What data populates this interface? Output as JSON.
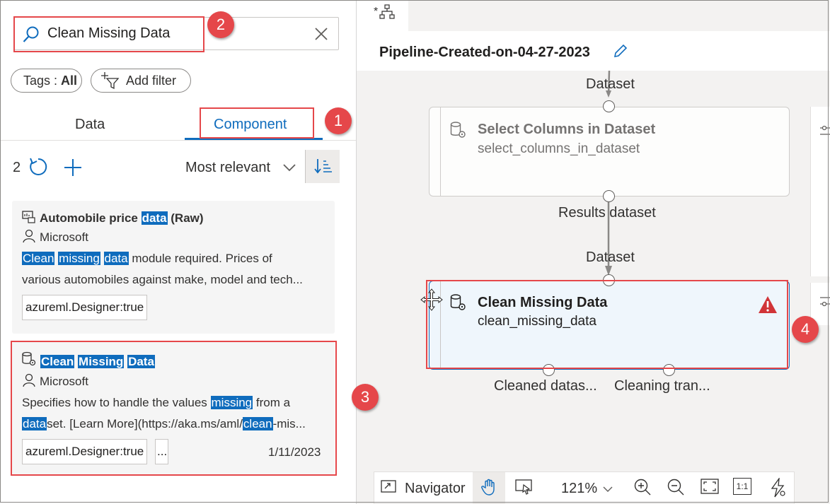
{
  "search": {
    "value": "Clean Missing Data",
    "placeholder": "Search"
  },
  "filters": {
    "tags_prefix": "Tags : ",
    "tags_value": "All",
    "add_filter": "Add filter"
  },
  "tabs": [
    {
      "label": "Data"
    },
    {
      "label": "Component"
    }
  ],
  "results": {
    "count": "2",
    "sort": "Most relevant"
  },
  "cards": [
    {
      "title_parts": [
        "Automobile price ",
        "data",
        " (Raw)"
      ],
      "publisher": "Microsoft",
      "desc_line1_parts": [
        "Clean",
        " ",
        "missing",
        " ",
        "data",
        " module required. Prices of"
      ],
      "desc_line2": "various automobiles against make, model and tech...",
      "tag": "azureml.Designer:true"
    },
    {
      "title_parts": [
        "Clean",
        " ",
        "Missing",
        " ",
        "Data"
      ],
      "publisher": "Microsoft",
      "desc_line1_parts": [
        "Specifies how to handle the values ",
        "missing",
        " from a"
      ],
      "desc_line2_parts": [
        "data",
        "set. [Learn More](https://aka.ms/aml/",
        "clean",
        "-mis..."
      ],
      "tag": "azureml.Designer:true",
      "more": "...",
      "date": "1/11/2023"
    }
  ],
  "badges": [
    "1",
    "2",
    "3",
    "4"
  ],
  "pipeline": {
    "tab_label": "*",
    "title": "Pipeline-Created-on-04-27-2023",
    "node1": {
      "title": "Select Columns in Dataset",
      "name": "select_columns_in_dataset"
    },
    "node2": {
      "title": "Clean Missing Data",
      "name": "clean_missing_data"
    },
    "port_labels": {
      "dataset_in_1": "Dataset",
      "results_out": "Results dataset",
      "dataset_in_2": "Dataset",
      "cleaned_out": "Cleaned datas...",
      "transform_out": "Cleaning tran..."
    }
  },
  "toolbar": {
    "navigator": "Navigator",
    "zoom": "121%",
    "one_to_one": "1:1"
  },
  "colors": {
    "accent": "#0f6cbd",
    "annotation_red": "#e5474a",
    "warning": "#d13438"
  }
}
